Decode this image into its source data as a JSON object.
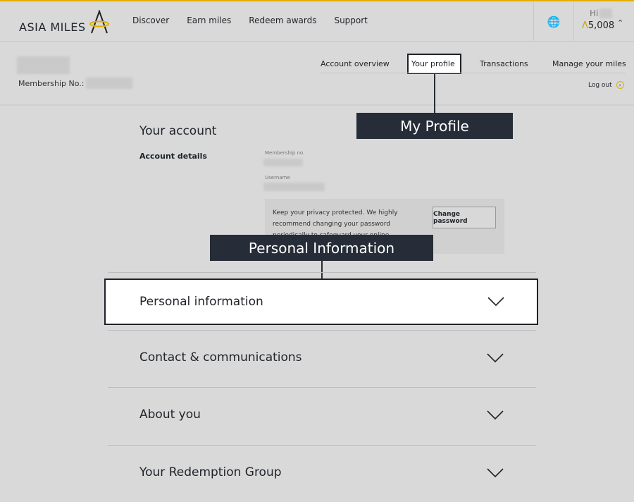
{
  "brand": {
    "logo_text": "ASIA MILES",
    "accent": "#e0b000"
  },
  "nav": [
    "Discover",
    "Earn miles",
    "Redeem awards",
    "Support"
  ],
  "header": {
    "globe_icon": "globe-icon",
    "greeting": "Hi",
    "miles_symbol": "Λ",
    "miles": "5,008"
  },
  "profile": {
    "membership_label": "Membership No.:"
  },
  "subnav": {
    "items": [
      "Account overview",
      "Your profile",
      "Transactions",
      "Manage your miles"
    ],
    "logout": "Log out"
  },
  "callouts": {
    "my_profile": "My Profile",
    "personal_information": "Personal Information"
  },
  "account": {
    "title": "Your account",
    "details_label": "Account details",
    "membership_no_label": "Membership no.",
    "username_label": "Username",
    "privacy_text": "Keep your privacy protected. We highly recommend changing your password periodically to safeguard your online security.",
    "change_password": "Change password"
  },
  "sections": [
    "Personal information",
    "Contact & communications",
    "About you",
    "Your Redemption Group"
  ]
}
